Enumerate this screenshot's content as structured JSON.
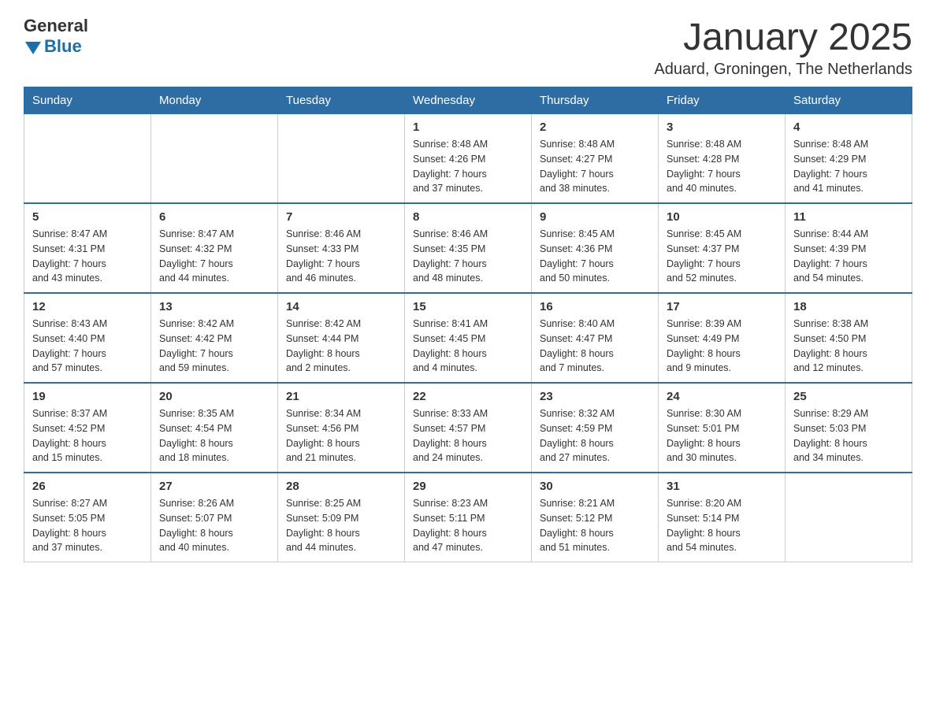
{
  "header": {
    "logo": {
      "text_general": "General",
      "text_blue": "Blue"
    },
    "title": "January 2025",
    "location": "Aduard, Groningen, The Netherlands"
  },
  "calendar": {
    "days_of_week": [
      "Sunday",
      "Monday",
      "Tuesday",
      "Wednesday",
      "Thursday",
      "Friday",
      "Saturday"
    ],
    "weeks": [
      [
        {
          "day": "",
          "info": ""
        },
        {
          "day": "",
          "info": ""
        },
        {
          "day": "",
          "info": ""
        },
        {
          "day": "1",
          "info": "Sunrise: 8:48 AM\nSunset: 4:26 PM\nDaylight: 7 hours\nand 37 minutes."
        },
        {
          "day": "2",
          "info": "Sunrise: 8:48 AM\nSunset: 4:27 PM\nDaylight: 7 hours\nand 38 minutes."
        },
        {
          "day": "3",
          "info": "Sunrise: 8:48 AM\nSunset: 4:28 PM\nDaylight: 7 hours\nand 40 minutes."
        },
        {
          "day": "4",
          "info": "Sunrise: 8:48 AM\nSunset: 4:29 PM\nDaylight: 7 hours\nand 41 minutes."
        }
      ],
      [
        {
          "day": "5",
          "info": "Sunrise: 8:47 AM\nSunset: 4:31 PM\nDaylight: 7 hours\nand 43 minutes."
        },
        {
          "day": "6",
          "info": "Sunrise: 8:47 AM\nSunset: 4:32 PM\nDaylight: 7 hours\nand 44 minutes."
        },
        {
          "day": "7",
          "info": "Sunrise: 8:46 AM\nSunset: 4:33 PM\nDaylight: 7 hours\nand 46 minutes."
        },
        {
          "day": "8",
          "info": "Sunrise: 8:46 AM\nSunset: 4:35 PM\nDaylight: 7 hours\nand 48 minutes."
        },
        {
          "day": "9",
          "info": "Sunrise: 8:45 AM\nSunset: 4:36 PM\nDaylight: 7 hours\nand 50 minutes."
        },
        {
          "day": "10",
          "info": "Sunrise: 8:45 AM\nSunset: 4:37 PM\nDaylight: 7 hours\nand 52 minutes."
        },
        {
          "day": "11",
          "info": "Sunrise: 8:44 AM\nSunset: 4:39 PM\nDaylight: 7 hours\nand 54 minutes."
        }
      ],
      [
        {
          "day": "12",
          "info": "Sunrise: 8:43 AM\nSunset: 4:40 PM\nDaylight: 7 hours\nand 57 minutes."
        },
        {
          "day": "13",
          "info": "Sunrise: 8:42 AM\nSunset: 4:42 PM\nDaylight: 7 hours\nand 59 minutes."
        },
        {
          "day": "14",
          "info": "Sunrise: 8:42 AM\nSunset: 4:44 PM\nDaylight: 8 hours\nand 2 minutes."
        },
        {
          "day": "15",
          "info": "Sunrise: 8:41 AM\nSunset: 4:45 PM\nDaylight: 8 hours\nand 4 minutes."
        },
        {
          "day": "16",
          "info": "Sunrise: 8:40 AM\nSunset: 4:47 PM\nDaylight: 8 hours\nand 7 minutes."
        },
        {
          "day": "17",
          "info": "Sunrise: 8:39 AM\nSunset: 4:49 PM\nDaylight: 8 hours\nand 9 minutes."
        },
        {
          "day": "18",
          "info": "Sunrise: 8:38 AM\nSunset: 4:50 PM\nDaylight: 8 hours\nand 12 minutes."
        }
      ],
      [
        {
          "day": "19",
          "info": "Sunrise: 8:37 AM\nSunset: 4:52 PM\nDaylight: 8 hours\nand 15 minutes."
        },
        {
          "day": "20",
          "info": "Sunrise: 8:35 AM\nSunset: 4:54 PM\nDaylight: 8 hours\nand 18 minutes."
        },
        {
          "day": "21",
          "info": "Sunrise: 8:34 AM\nSunset: 4:56 PM\nDaylight: 8 hours\nand 21 minutes."
        },
        {
          "day": "22",
          "info": "Sunrise: 8:33 AM\nSunset: 4:57 PM\nDaylight: 8 hours\nand 24 minutes."
        },
        {
          "day": "23",
          "info": "Sunrise: 8:32 AM\nSunset: 4:59 PM\nDaylight: 8 hours\nand 27 minutes."
        },
        {
          "day": "24",
          "info": "Sunrise: 8:30 AM\nSunset: 5:01 PM\nDaylight: 8 hours\nand 30 minutes."
        },
        {
          "day": "25",
          "info": "Sunrise: 8:29 AM\nSunset: 5:03 PM\nDaylight: 8 hours\nand 34 minutes."
        }
      ],
      [
        {
          "day": "26",
          "info": "Sunrise: 8:27 AM\nSunset: 5:05 PM\nDaylight: 8 hours\nand 37 minutes."
        },
        {
          "day": "27",
          "info": "Sunrise: 8:26 AM\nSunset: 5:07 PM\nDaylight: 8 hours\nand 40 minutes."
        },
        {
          "day": "28",
          "info": "Sunrise: 8:25 AM\nSunset: 5:09 PM\nDaylight: 8 hours\nand 44 minutes."
        },
        {
          "day": "29",
          "info": "Sunrise: 8:23 AM\nSunset: 5:11 PM\nDaylight: 8 hours\nand 47 minutes."
        },
        {
          "day": "30",
          "info": "Sunrise: 8:21 AM\nSunset: 5:12 PM\nDaylight: 8 hours\nand 51 minutes."
        },
        {
          "day": "31",
          "info": "Sunrise: 8:20 AM\nSunset: 5:14 PM\nDaylight: 8 hours\nand 54 minutes."
        },
        {
          "day": "",
          "info": ""
        }
      ]
    ]
  }
}
